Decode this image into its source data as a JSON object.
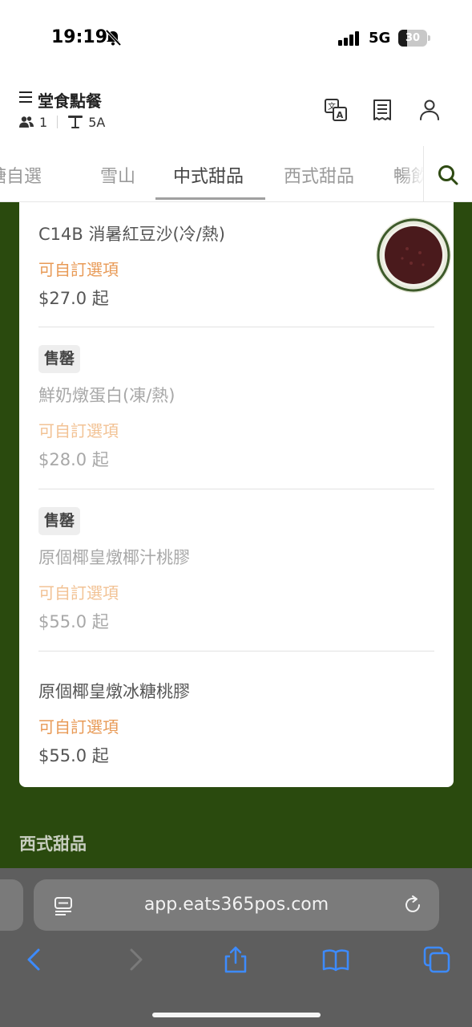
{
  "status_bar": {
    "time": "19:19",
    "network": "5G",
    "battery": "30",
    "battery_fraction": 0.3,
    "icons": [
      "bell-muted-icon",
      "cellular-signal-icon",
      "battery-icon"
    ]
  },
  "header": {
    "title": "堂食點餐",
    "guests": "1",
    "table": "5A",
    "icons": [
      "menu-icon",
      "people-icon",
      "table-icon",
      "translate-icon",
      "receipt-icon",
      "user-icon"
    ]
  },
  "tabs": [
    {
      "label": "糖自選",
      "active": false
    },
    {
      "label": "雪山",
      "active": false
    },
    {
      "label": "中式甜品",
      "active": true
    },
    {
      "label": "西式甜品",
      "active": false
    },
    {
      "label": "暢飲",
      "active": false
    }
  ],
  "menu_items": [
    {
      "name": "C14B 消暑紅豆沙(冷/熱)",
      "badge": "",
      "option": "可自訂選項",
      "price": "$27.0 起",
      "sold_out": false,
      "has_image": true
    },
    {
      "name": "鮮奶燉蛋白(凍/熱)",
      "badge": "售罄",
      "option": "可自訂選項",
      "price": "$28.0 起",
      "sold_out": true,
      "has_image": false
    },
    {
      "name": "原個椰皇燉椰汁桃膠",
      "badge": "售罄",
      "option": "可自訂選項",
      "price": "$55.0 起",
      "sold_out": true,
      "has_image": false
    },
    {
      "name": "原個椰皇燉冰糖桃膠",
      "badge": "",
      "option": "可自訂選項",
      "price": "$55.0 起",
      "sold_out": false,
      "has_image": false
    }
  ],
  "next_section_title": "西式甜品",
  "browser": {
    "url": "app.eats365pos.com",
    "icons": [
      "page-menu-icon",
      "reload-icon",
      "back-icon",
      "forward-icon",
      "share-icon",
      "bookmarks-icon",
      "tabs-icon"
    ]
  },
  "colors": {
    "background_green": "#2a4a0e",
    "option_orange": "#e89a56",
    "accent_dark_green": "#2e4a12"
  }
}
